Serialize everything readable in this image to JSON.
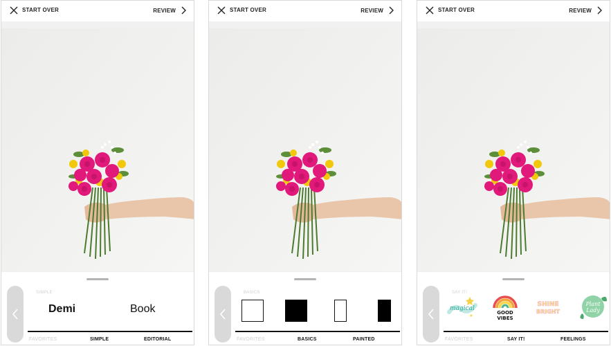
{
  "colors": {
    "accent_underline": "#aee5df",
    "tray_gray": "#d9d9d9",
    "flower_pink": "#e0197a",
    "flower_yellow": "#f2c80c"
  },
  "common": {
    "start_over": "START OVER",
    "review": "REVIEW"
  },
  "panels": [
    {
      "category": "SIMPLE",
      "tabs": {
        "favorites": "FAVORITES",
        "active": "SIMPLE",
        "other": "EDITORIAL"
      },
      "options": [
        "Demi",
        "Book"
      ]
    },
    {
      "category": "BASICS",
      "tabs": {
        "favorites": "FAVORITES",
        "active": "BASICS",
        "other": "PAINTED"
      },
      "options": [
        "white-frame",
        "black-frame",
        "thin-white-frame",
        "black-tall-frame"
      ]
    },
    {
      "category": "SAY IT!",
      "tabs": {
        "favorites": "FAVORITES",
        "active": "SAY IT!",
        "other": "FEELINGS"
      },
      "stickers": {
        "magical": "magical",
        "good_vibes_1": "GOOD",
        "good_vibes_2": "VIBES",
        "shine_1": "SHINE",
        "shine_2": "BRIGHT",
        "plant_lady_1": "Plant",
        "plant_lady_2": "Lady"
      }
    }
  ]
}
